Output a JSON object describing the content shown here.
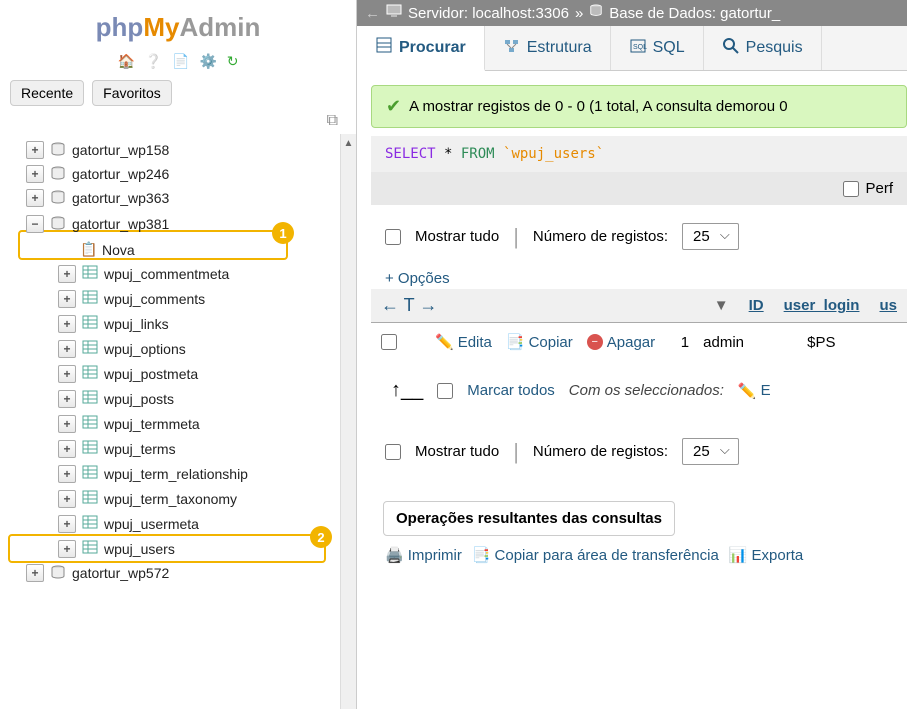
{
  "logo": {
    "php": "php",
    "my": "My",
    "admin": "Admin"
  },
  "sidebar_tabs": {
    "recent": "Recente",
    "fav": "Favoritos"
  },
  "tree": {
    "dbs_collapsed": [
      "gatortur_wp158",
      "gatortur_wp246",
      "gatortur_wp363"
    ],
    "db_expanded": "gatortur_wp381",
    "nova": "Nova",
    "tables": [
      "wpuj_commentmeta",
      "wpuj_comments",
      "wpuj_links",
      "wpuj_options",
      "wpuj_postmeta",
      "wpuj_posts",
      "wpuj_termmeta",
      "wpuj_terms",
      "wpuj_term_relationship",
      "wpuj_term_taxonomy",
      "wpuj_usermeta",
      "wpuj_users"
    ],
    "db_last": "gatortur_wp572",
    "badge1": "1",
    "badge2": "2"
  },
  "breadcrumb": {
    "server_label": "Servidor: localhost:3306",
    "db_label": "Base de Dados: gatortur_"
  },
  "tabs": {
    "browse": "Procurar",
    "structure": "Estrutura",
    "sql": "SQL",
    "search": "Pesquis"
  },
  "success_msg": "A mostrar registos de 0 - 0 (1 total, A consulta demorou 0",
  "sql": {
    "select": "SELECT",
    "star": " * ",
    "from": "FROM",
    "tbl": " `wpuj_users`"
  },
  "profile_label": "Perf",
  "controls": {
    "show_all": "Mostrar tudo",
    "rows_label": "Número de registos:",
    "rows_value": "25"
  },
  "options_link": "+ Opções",
  "cols": {
    "id": "ID",
    "user_login": "user_login",
    "us": "us"
  },
  "row": {
    "edit": "Edita",
    "copy": "Copiar",
    "delete": "Apagar",
    "id": "1",
    "user_login": "admin",
    "pw": "$PS"
  },
  "check_all": "Marcar todos",
  "with_selected": "Com os seleccionados:",
  "edit_abbrev": "E",
  "result_ops_title": "Operações resultantes das consultas",
  "result_links": {
    "print": "Imprimir",
    "copy_clip": "Copiar para área de transferência",
    "export": "Exporta"
  }
}
